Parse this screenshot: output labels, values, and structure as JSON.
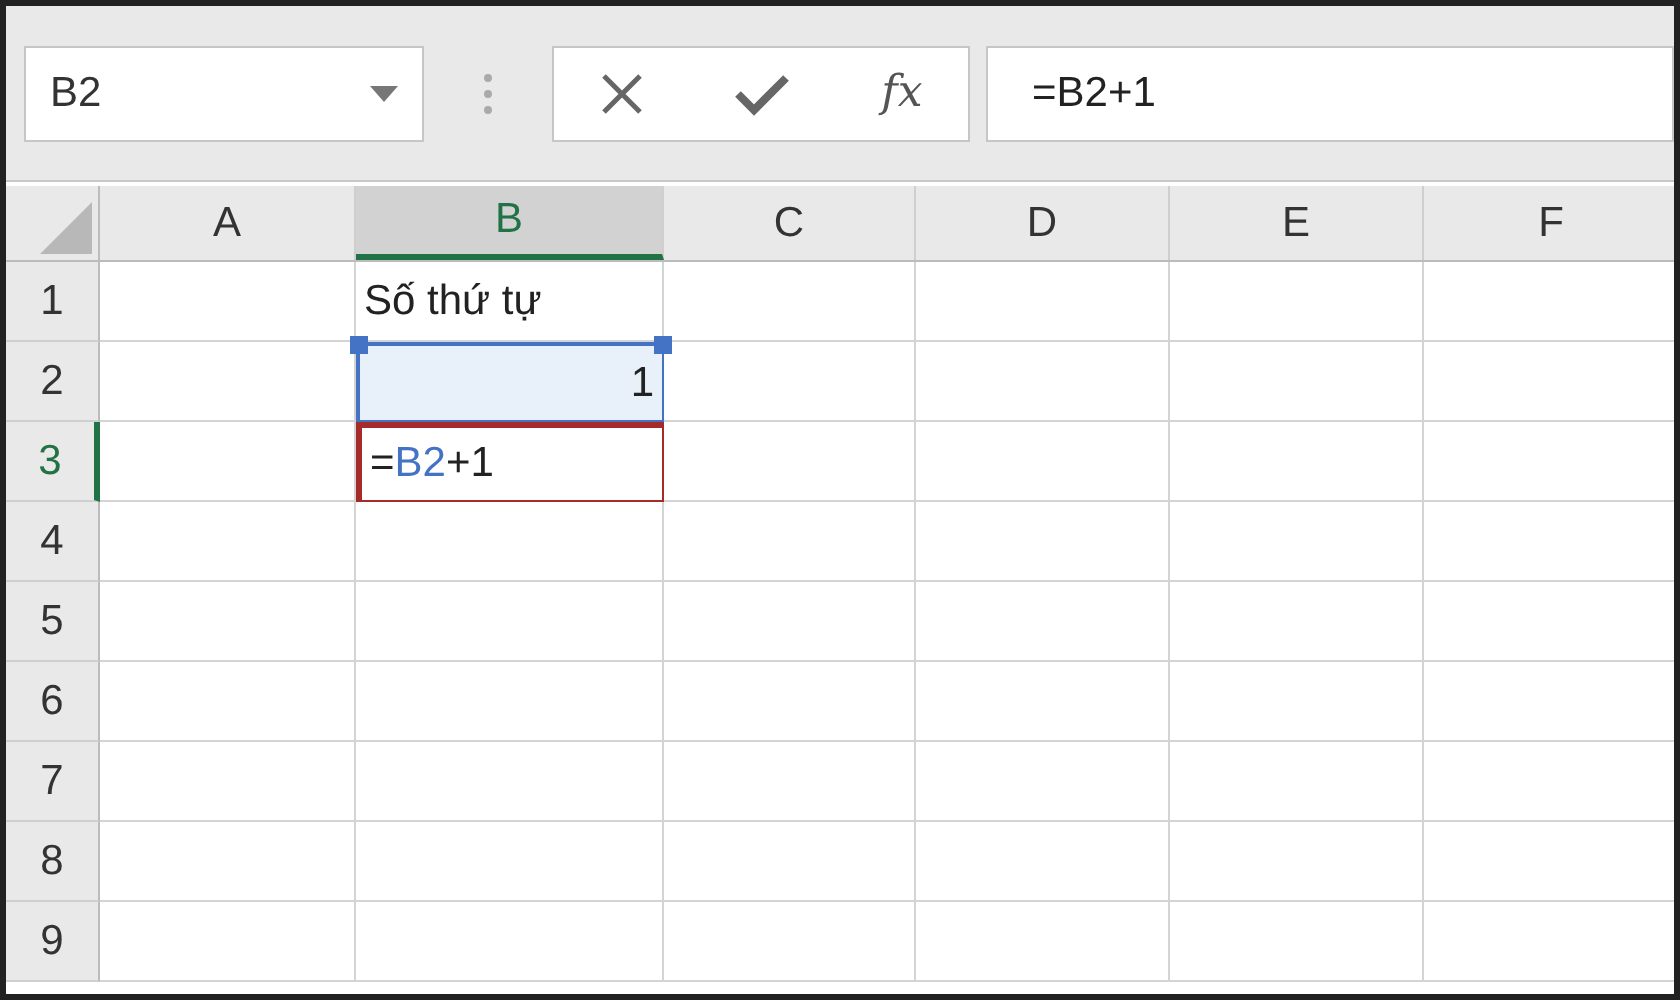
{
  "name_box": {
    "value": "B2"
  },
  "formula_bar": {
    "insert_function_label": "fx",
    "value": "=B2+1"
  },
  "columns": [
    {
      "label": "A",
      "selected": false
    },
    {
      "label": "B",
      "selected": true
    },
    {
      "label": "C",
      "selected": false
    },
    {
      "label": "D",
      "selected": false
    },
    {
      "label": "E",
      "selected": false
    },
    {
      "label": "F",
      "selected": false
    }
  ],
  "rows": [
    {
      "label": "1",
      "selected": false,
      "cells": [
        {},
        {
          "kind": "text",
          "text": "Số thứ tự",
          "highlighted": false,
          "editing": false
        },
        {},
        {},
        {},
        {}
      ]
    },
    {
      "label": "2",
      "selected": false,
      "cells": [
        {},
        {
          "kind": "number",
          "text": "1",
          "highlighted": true,
          "editing": false
        },
        {},
        {},
        {},
        {}
      ]
    },
    {
      "label": "3",
      "selected": true,
      "cells": [
        {},
        {
          "kind": "formula",
          "parts": [
            {
              "kind": "plain",
              "text": "="
            },
            {
              "kind": "reference",
              "text": "B2"
            },
            {
              "kind": "plain",
              "text": "+1"
            }
          ],
          "highlighted": false,
          "editing": true
        },
        {},
        {},
        {},
        {}
      ]
    },
    {
      "label": "4",
      "selected": false,
      "cells": [
        {},
        {},
        {},
        {},
        {},
        {}
      ]
    },
    {
      "label": "5",
      "selected": false,
      "cells": [
        {},
        {},
        {},
        {},
        {},
        {}
      ]
    },
    {
      "label": "6",
      "selected": false,
      "cells": [
        {},
        {},
        {},
        {},
        {},
        {}
      ]
    },
    {
      "label": "7",
      "selected": false,
      "cells": [
        {},
        {},
        {},
        {},
        {},
        {}
      ]
    },
    {
      "label": "8",
      "selected": false,
      "cells": [
        {},
        {},
        {},
        {},
        {},
        {}
      ]
    },
    {
      "label": "9",
      "selected": false,
      "cells": [
        {},
        {},
        {},
        {},
        {},
        {}
      ]
    }
  ]
}
